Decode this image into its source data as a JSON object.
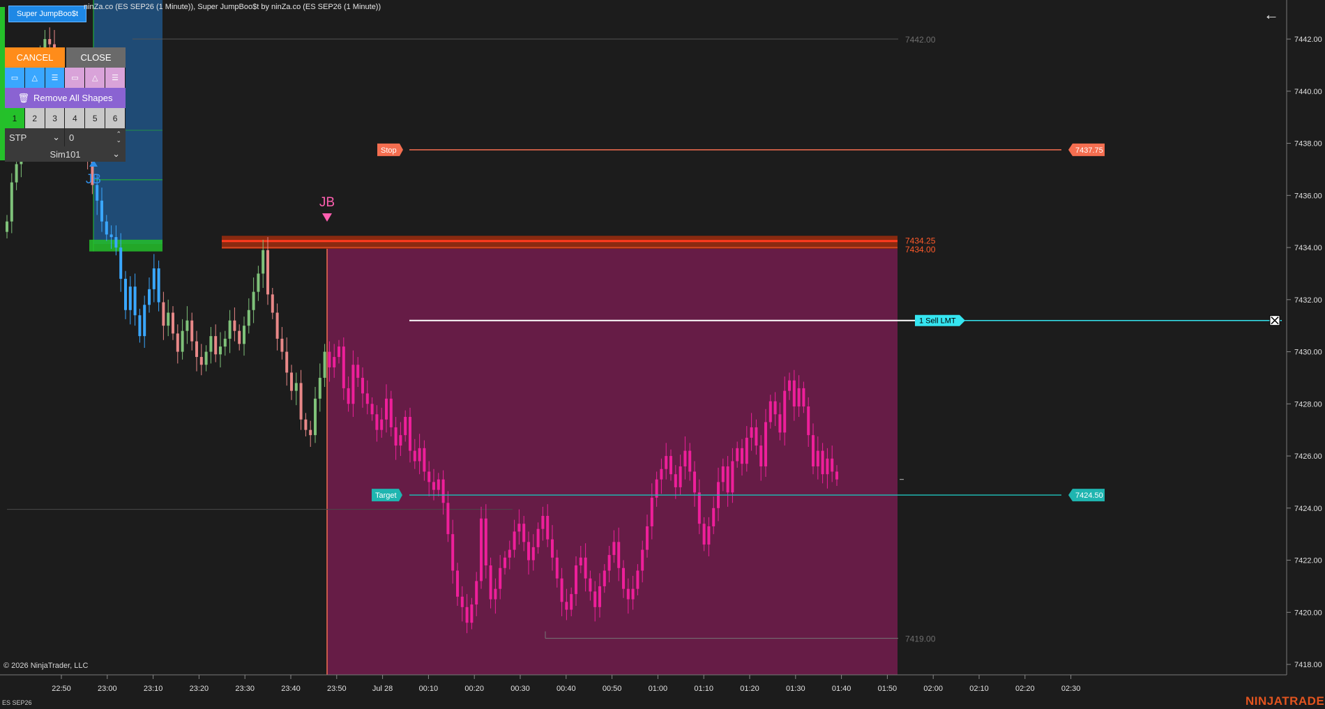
{
  "header": {
    "title": "ninZa.co (ES SEP26 (1 Minute)), Super JumpBoo$t by ninZa.co (ES SEP26 (1 Minute))",
    "indicator_button": "Super JumpBoo$t"
  },
  "panel": {
    "cancel_label": "CANCEL",
    "close_label": "CLOSE",
    "remove_all_label": "Remove All Shapes",
    "shape_buttons": [
      {
        "icon": "rectangle-icon",
        "glyph": "▭"
      },
      {
        "icon": "triangle-icon",
        "glyph": "△"
      },
      {
        "icon": "lines-icon",
        "glyph": "☰"
      },
      {
        "icon": "rectangle-icon",
        "glyph": "▭"
      },
      {
        "icon": "triangle-icon",
        "glyph": "△"
      },
      {
        "icon": "lines-icon",
        "glyph": "☰"
      }
    ],
    "numbers": [
      "1",
      "2",
      "3",
      "4",
      "5",
      "6"
    ],
    "selected_number": "1",
    "order_type": "STP",
    "quantity": "0",
    "account": "Sim101"
  },
  "orders": {
    "stop_label": "Stop",
    "stop_price": "7437.75",
    "target_label": "Target",
    "target_price": "7424.50",
    "sell_lmt_label": "1  Sell LMT",
    "zone_top": "7434.25",
    "zone_bottom": "7434.00",
    "level_high": "7442.00",
    "level_low": "7419.00"
  },
  "markers": [
    {
      "label": "JB",
      "direction": "up",
      "color": "#2f8fe8"
    },
    {
      "label": "JB",
      "direction": "down",
      "color": "#ff5fb0"
    }
  ],
  "chart_data": {
    "type": "candlestick",
    "instrument": "ES SEP26",
    "y_ticks": [
      "7442.00",
      "7440.00",
      "7438.00",
      "7436.00",
      "7434.00",
      "7432.00",
      "7430.00",
      "7428.00",
      "7426.00",
      "7424.00",
      "7422.00",
      "7420.00",
      "7418.00"
    ],
    "ylim": [
      7417.6,
      7443.5
    ],
    "x_ticks": [
      "22:50",
      "23:00",
      "23:10",
      "23:20",
      "23:30",
      "23:40",
      "23:50",
      "Jul 28",
      "00:10",
      "00:20",
      "00:30",
      "00:40",
      "00:50",
      "01:00",
      "01:10",
      "01:20",
      "01:30",
      "01:40",
      "01:50",
      "02:00",
      "02:10",
      "02:20",
      "02:30"
    ],
    "closes": [
      7435.0,
      7436.5,
      7437.2,
      7437.8,
      7438.5,
      7439.5,
      7440.8,
      7441.5,
      7442.0,
      7441.8,
      7440.5,
      7439.6,
      7439.0,
      7439.8,
      7440.4,
      7438.9,
      7438.2,
      7437.5,
      7436.4,
      7435.8,
      7435.0,
      7434.5,
      7434.4,
      7434.0,
      7432.8,
      7431.6,
      7432.5,
      7431.4,
      7430.6,
      7431.8,
      7432.4,
      7433.2,
      7431.9,
      7431.0,
      7431.5,
      7430.7,
      7430.0,
      7430.8,
      7431.2,
      7430.4,
      7429.8,
      7429.5,
      7430.0,
      7430.6,
      7429.9,
      7430.2,
      7430.5,
      7431.2,
      7430.8,
      7430.3,
      7431.0,
      7431.6,
      7432.3,
      7433.0,
      7433.9,
      7432.2,
      7431.5,
      7430.5,
      7430.0,
      7429.2,
      7428.5,
      7428.8,
      7427.4,
      7427.0,
      7426.8,
      7428.2,
      7429.0,
      7430.0,
      7429.4,
      7429.8,
      7430.2,
      7428.6,
      7428.0,
      7429.5,
      7429.0,
      7428.4,
      7428.0,
      7427.6,
      7427.0,
      7427.4,
      7428.2,
      7427.1,
      7426.4,
      7426.8,
      7427.5,
      7426.2,
      7425.8,
      7426.3,
      7425.4,
      7425.0,
      7424.7,
      7425.1,
      7424.2,
      7423.0,
      7421.6,
      7420.6,
      7420.2,
      7419.6,
      7420.3,
      7421.2,
      7423.6,
      7421.8,
      7420.5,
      7420.9,
      7421.7,
      7422.1,
      7422.4,
      7423.1,
      7423.4,
      7422.7,
      7422.0,
      7422.5,
      7423.2,
      7423.7,
      7422.8,
      7422.1,
      7421.3,
      7420.4,
      7420.1,
      7420.7,
      7421.8,
      7422.1,
      7421.3,
      7420.8,
      7420.2,
      7421.0,
      7421.6,
      7422.2,
      7422.7,
      7421.7,
      7420.9,
      7420.5,
      7420.9,
      7421.6,
      7422.4,
      7423.3,
      7424.4,
      7425.1,
      7425.5,
      7426.0,
      7425.3,
      7424.8,
      7425.6,
      7426.2,
      7425.4,
      7424.6,
      7423.4,
      7422.6,
      7423.3,
      7424.0,
      7425.0,
      7425.6,
      7424.6,
      7425.8,
      7426.3,
      7425.7,
      7426.7,
      7427.1,
      7426.4,
      7425.6,
      7427.3,
      7428.1,
      7427.6,
      7426.9,
      7428.5,
      7428.9,
      7427.9,
      7428.6,
      7427.9,
      7426.8,
      7425.6,
      7426.2,
      7425.3,
      7425.9,
      7425.4,
      7425.1
    ]
  },
  "copyright": "© 2026 NinjaTrader, LLC",
  "instrument_label": "ES SEP26",
  "logo": "NINJATRADER",
  "colors": {
    "background": "#1c1c1c",
    "zone_fill": "#661c46",
    "candle_down": "#ee1f9a",
    "candle_up_left": "#7fc27a",
    "stop": "#f46e50",
    "target": "#1fb5b0",
    "sell_lmt": "#35e5f0",
    "blue_zone": "#1f4b75"
  }
}
